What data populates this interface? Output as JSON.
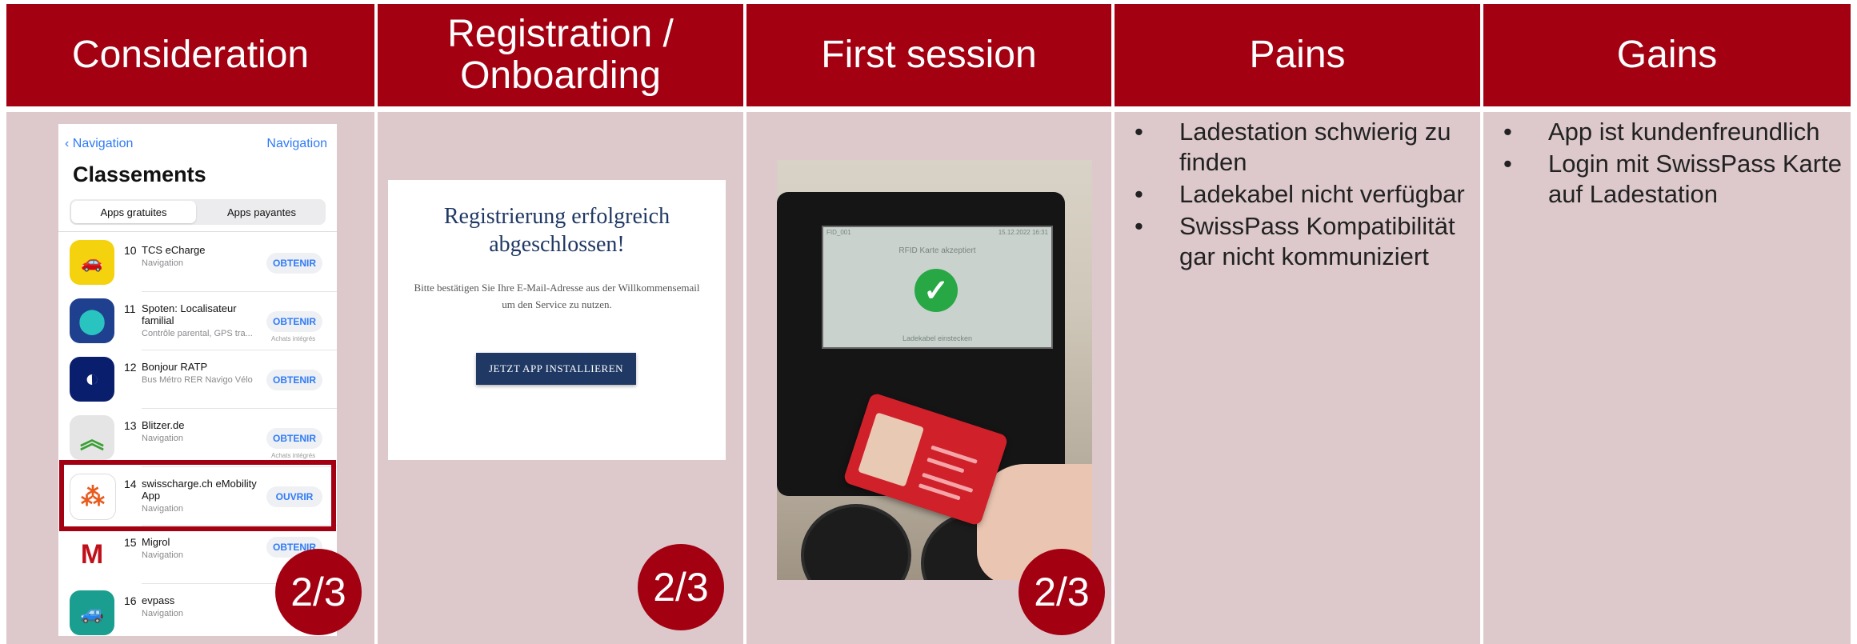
{
  "headers": [
    "Consideration",
    "Registration / Onboarding",
    "First session",
    "Pains",
    "Gains"
  ],
  "colors": {
    "header_bg": "#a30012",
    "cell_bg": "#ddc9cb",
    "badge_bg": "#a30012"
  },
  "badges": [
    "2/3",
    "2/3",
    "2/3"
  ],
  "appstore": {
    "back_label": "Navigation",
    "right_label": "Navigation",
    "title": "Classements",
    "segments": [
      "Apps gratuites",
      "Apps payantes"
    ],
    "apps": [
      {
        "rank": "10",
        "name": "TCS eCharge",
        "category": "Navigation",
        "button": "OBTENIR",
        "note": "",
        "icon": "tcs-car-icon"
      },
      {
        "rank": "11",
        "name": "Spoten: Localisateur familial",
        "category": "Contrôle parental, GPS tra...",
        "button": "OBTENIR",
        "note": "Achats intégrés",
        "icon": "map-pin-icon"
      },
      {
        "rank": "12",
        "name": "Bonjour RATP",
        "category": "Bus Métro RER Navigo Vélo",
        "button": "OBTENIR",
        "note": "",
        "icon": "ratp-icon"
      },
      {
        "rank": "13",
        "name": "Blitzer.de",
        "category": "Navigation",
        "button": "OBTENIR",
        "note": "Achats intégrés",
        "icon": "chevrons-up-icon"
      },
      {
        "rank": "14",
        "name": "swisscharge.ch eMobility App",
        "category": "Navigation",
        "button": "OUVRIR",
        "note": "",
        "icon": "swisscharge-icon"
      },
      {
        "rank": "15",
        "name": "Migrol",
        "category": "Navigation",
        "button": "OBTENIR",
        "note": "",
        "icon": "migrol-icon"
      },
      {
        "rank": "16",
        "name": "evpass",
        "category": "Navigation",
        "button": "",
        "note": "",
        "icon": "evpass-car-icon"
      }
    ]
  },
  "registration": {
    "title": "Registrierung erfolgreich abgeschlossen!",
    "text": "Bitte bestätigen Sie Ihre E-Mail-Adresse aus der Willkommensemail um den Service zu nutzen.",
    "button": "JETZT APP INSTALLIEREN"
  },
  "terminal": {
    "top_left": "FID_001",
    "top_right": "15.12.2022 16:31",
    "message": "RFID Karte akzeptiert",
    "bottom": "Ladekabel einstecken"
  },
  "pains": [
    "Ladestation schwierig zu finden",
    "Ladekabel nicht verfügbar",
    "SwissPass Kompatibilität gar nicht kommuniziert"
  ],
  "gains": [
    "App ist kundenfreundlich",
    "Login mit SwissPass Karte auf Ladestation"
  ]
}
